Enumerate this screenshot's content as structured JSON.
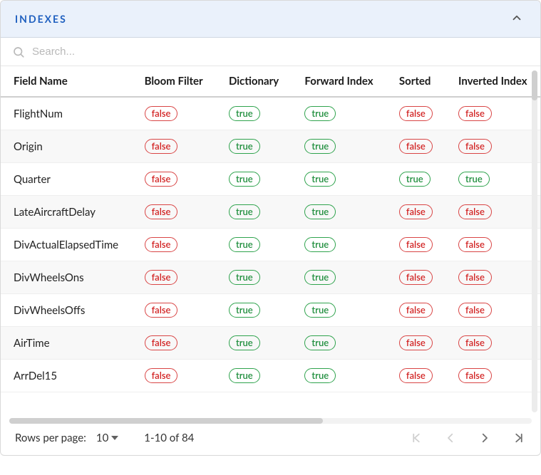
{
  "header": {
    "title": "INDEXES"
  },
  "search": {
    "placeholder": "Search..."
  },
  "columns": [
    "Field Name",
    "Bloom Filter",
    "Dictionary",
    "Forward Index",
    "Sorted",
    "Inverted Index"
  ],
  "rows": [
    {
      "field": "FlightNum",
      "bloom": "false",
      "dict": "true",
      "forward": "true",
      "sorted": "false",
      "inverted": "false"
    },
    {
      "field": "Origin",
      "bloom": "false",
      "dict": "true",
      "forward": "true",
      "sorted": "false",
      "inverted": "false"
    },
    {
      "field": "Quarter",
      "bloom": "false",
      "dict": "true",
      "forward": "true",
      "sorted": "true",
      "inverted": "true"
    },
    {
      "field": "LateAircraftDelay",
      "bloom": "false",
      "dict": "true",
      "forward": "true",
      "sorted": "false",
      "inverted": "false"
    },
    {
      "field": "DivActualElapsedTime",
      "bloom": "false",
      "dict": "true",
      "forward": "true",
      "sorted": "false",
      "inverted": "false"
    },
    {
      "field": "DivWheelsOns",
      "bloom": "false",
      "dict": "true",
      "forward": "true",
      "sorted": "false",
      "inverted": "false"
    },
    {
      "field": "DivWheelsOffs",
      "bloom": "false",
      "dict": "true",
      "forward": "true",
      "sorted": "false",
      "inverted": "false"
    },
    {
      "field": "AirTime",
      "bloom": "false",
      "dict": "true",
      "forward": "true",
      "sorted": "false",
      "inverted": "false"
    },
    {
      "field": "ArrDel15",
      "bloom": "false",
      "dict": "true",
      "forward": "true",
      "sorted": "false",
      "inverted": "false"
    }
  ],
  "pagination": {
    "rows_per_page_label": "Rows per page:",
    "rows_per_page_value": "10",
    "range_label": "1-10 of 84"
  }
}
